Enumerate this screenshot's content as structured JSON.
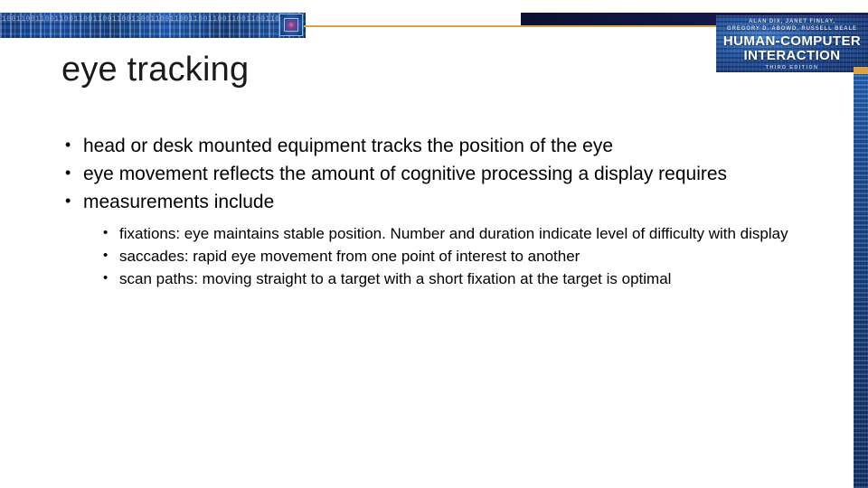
{
  "slide": {
    "title": "eye tracking",
    "bullets": [
      {
        "level": 1,
        "text": "head or desk mounted equipment tracks the position of the eye"
      },
      {
        "level": 1,
        "text": "eye movement reflects the amount of cognitive processing a display requires"
      },
      {
        "level": 1,
        "text": "measurements include"
      }
    ],
    "sub_bullets": [
      {
        "level": 2,
        "text": "fixations: eye maintains stable position. Number and duration indicate level of difficulty with display"
      },
      {
        "level": 2,
        "text": "saccades: rapid eye movement from one point of interest to another"
      },
      {
        "level": 2,
        "text": "scan paths: moving straight to a target with a short fixation at the target is optimal"
      }
    ]
  },
  "decoration": {
    "banner_binary": "1001100110011001100110011001100110011001100110011001100110011001100110011001100110011001\n0100100010100100010100100010100100010100100010100100010100100010100100010100100010",
    "banner_icon_name": "chip-icon",
    "gold_rule_color": "#d9a349",
    "banner_blue": "#1b52a8",
    "strip_blue": "#1d4f9c"
  },
  "book": {
    "authors_line_1": "ALAN DIX, JANET FINLAY,",
    "authors_line_2": "GREGORY D. ABOWD, RUSSELL BEALE",
    "title_line_1": "HUMAN-COMPUTER",
    "title_line_2": "INTERACTION",
    "edition": "THIRD EDITION"
  }
}
